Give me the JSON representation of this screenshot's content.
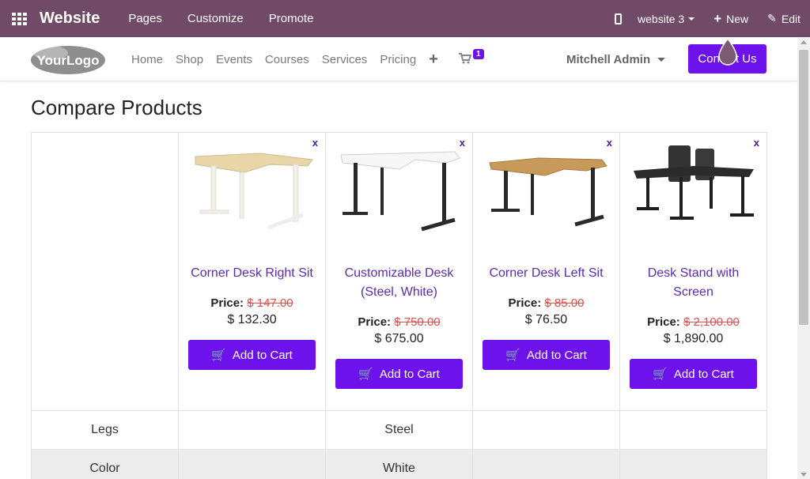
{
  "admin_bar": {
    "brand": "Website",
    "menu": [
      "Pages",
      "Customize",
      "Promote"
    ],
    "website_select": "website 3",
    "new_label": "New",
    "edit_label": "Edit"
  },
  "navbar": {
    "logo_text": "YourLogo",
    "links": [
      "Home",
      "Shop",
      "Events",
      "Courses",
      "Services",
      "Pricing"
    ],
    "cart_count": "1",
    "user": "Mitchell Admin",
    "contact_label": "Contact Us"
  },
  "page": {
    "title": "Compare Products"
  },
  "products": [
    {
      "name": "Corner Desk Right Sit",
      "price_label": "Price:",
      "old_price": "$ 147.00",
      "price": "$ 132.30",
      "button": "Add to Cart",
      "remove": "x"
    },
    {
      "name": "Customizable Desk (Steel, White)",
      "price_label": "Price:",
      "old_price": "$ 750.00",
      "price": "$ 675.00",
      "button": "Add to Cart",
      "remove": "x"
    },
    {
      "name": "Corner Desk Left Sit",
      "price_label": "Price:",
      "old_price": "$ 85.00",
      "price": "$ 76.50",
      "button": "Add to Cart",
      "remove": "x"
    },
    {
      "name": "Desk Stand with Screen",
      "price_label": "Price:",
      "old_price": "$ 2,100.00",
      "price": "$ 1,890.00",
      "button": "Add to Cart",
      "remove": "x"
    }
  ],
  "attributes": [
    {
      "name": "Legs",
      "values": [
        "",
        "Steel",
        "",
        ""
      ]
    },
    {
      "name": "Color",
      "values": [
        "",
        "White",
        "",
        ""
      ]
    }
  ],
  "colors": {
    "admin_bar": "#704a66",
    "accent": "#6e12ec",
    "link": "#5b2ab0",
    "strike_price": "#d9534f"
  }
}
